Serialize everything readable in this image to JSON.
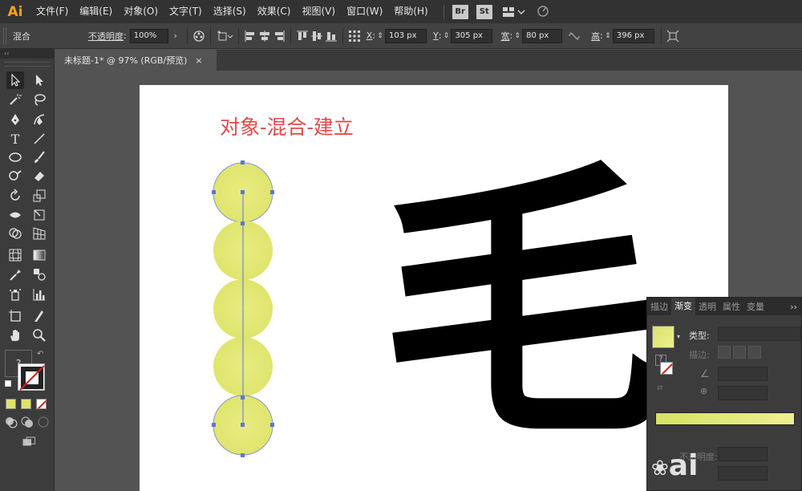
{
  "app": {
    "logo": "Ai"
  },
  "menu": {
    "items": [
      "文件(F)",
      "编辑(E)",
      "对象(O)",
      "文字(T)",
      "选择(S)",
      "效果(C)",
      "视图(V)",
      "窗口(W)",
      "帮助(H)"
    ],
    "badges": [
      "Br",
      "St"
    ]
  },
  "controlbar": {
    "mode_label": "混合",
    "opacity_label": "不透明度",
    "opacity_value": "100%",
    "x_label": "X",
    "x_value": "103 px",
    "y_label": "Y",
    "y_value": "305 px",
    "w_label": "宽",
    "w_value": "80 px",
    "h_label": "高",
    "h_value": "396 px"
  },
  "document": {
    "tab_title": "未标题-1* @ 97% (RGB/预览)",
    "close_glyph": "×"
  },
  "artboard": {
    "annotation": "对象-混合-建立",
    "character": "毛",
    "blend_color": "#e4e874"
  },
  "tools": {
    "type_glyph": "T",
    "fill_glyph": "?"
  },
  "gradient_panel": {
    "tabs": [
      "描边",
      "渐变",
      "透明",
      "属性",
      "变量"
    ],
    "active_tab": "渐变",
    "type_label": "类型",
    "stroke_label": "描边",
    "opacity_label": "不透明度",
    "question_glyph": "?",
    "collapse_glyph": "››",
    "gradient_start": "#d7e064",
    "gradient_end": "#eef090"
  },
  "watermark": "ai"
}
